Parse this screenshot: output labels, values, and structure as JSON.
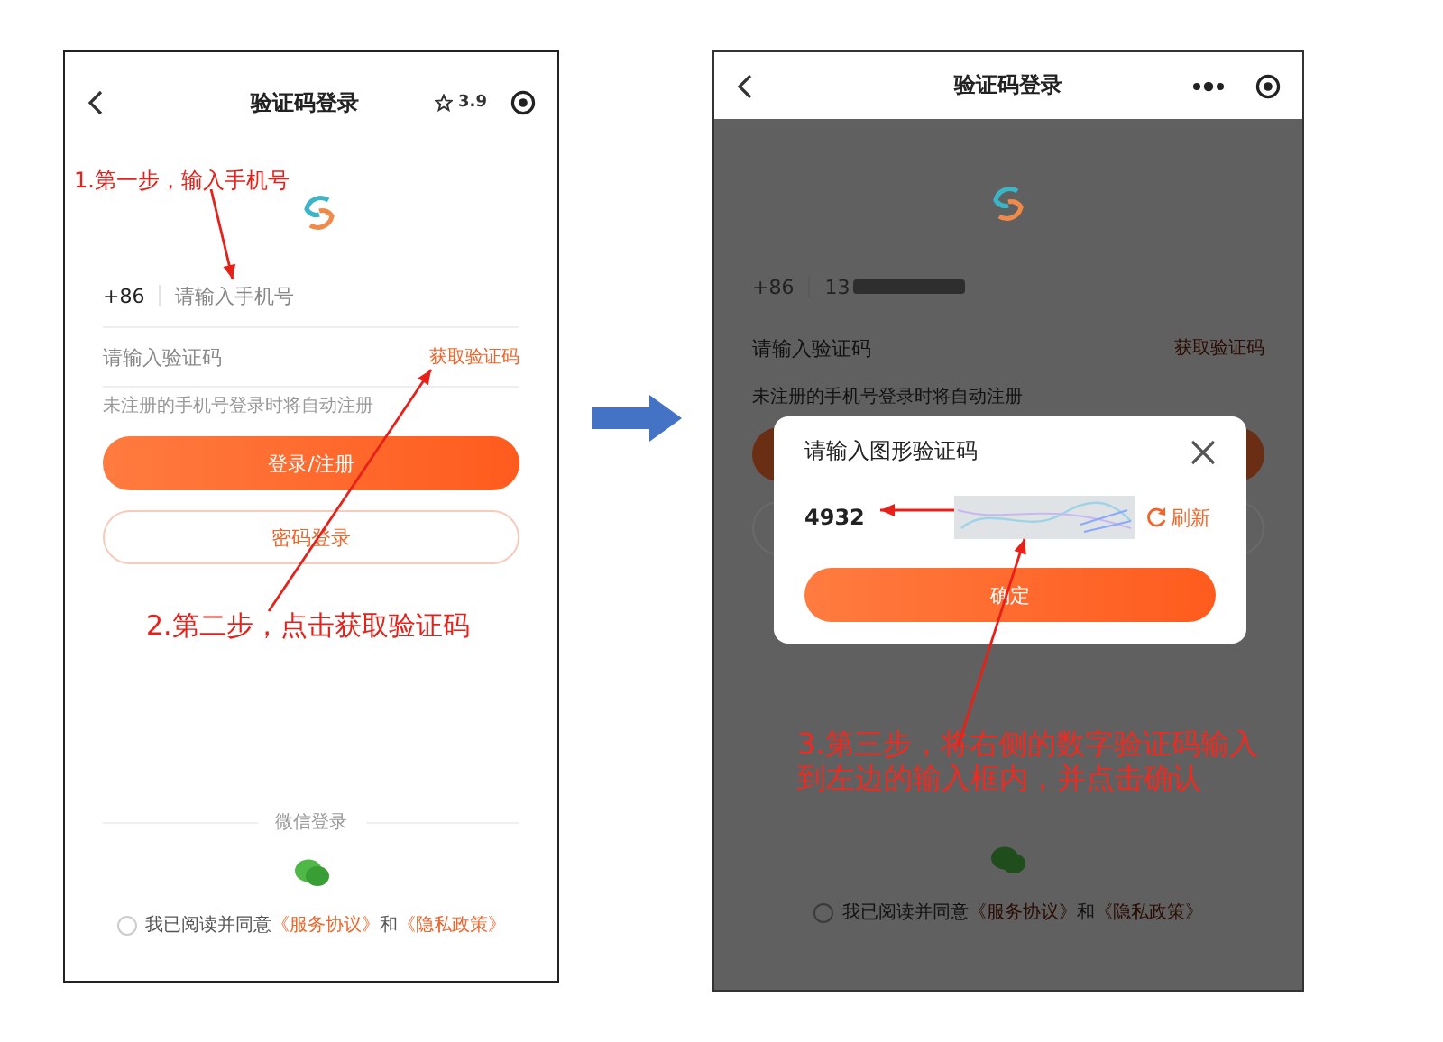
{
  "screens": [
    {
      "dimmed": false,
      "nav": {
        "title": "验证码登录",
        "rating": "3.9"
      },
      "phone_field": {
        "prefix": "+86",
        "placeholder": "请输入手机号"
      },
      "code_field": {
        "placeholder": "请输入验证码",
        "action": "获取验证码"
      },
      "hint": "未注册的手机号登录时将自动注册",
      "buttons": [
        {
          "kind": "primary",
          "label": "登录/注册"
        },
        {
          "kind": "outline",
          "label": "密码登录"
        }
      ],
      "wechat_label": "微信登录",
      "agreement": {
        "checked": false,
        "text": "我已阅读并同意",
        "links": [
          "《服务协议》",
          "《隐私政策》"
        ],
        "joiner": "和"
      },
      "annotations": [
        {
          "text": "1.第一步，输入手机号"
        },
        {
          "text": "2.第二步，点击获取验证码"
        }
      ]
    },
    {
      "dimmed": true,
      "nav": {
        "title": "验证码登录"
      },
      "phone_field": {
        "prefix": "+86",
        "value": "13",
        "masked": true
      },
      "code_field": {
        "placeholder": "请输入验证码",
        "action": "获取验证码"
      },
      "hint": "未注册的手机号登录时将自动注册",
      "buttons": [
        {
          "kind": "primary"
        },
        {
          "kind": "outline"
        }
      ],
      "agreement": {
        "checked": false,
        "text": "我已阅读并同意",
        "links": [
          "《服务协议》",
          "《隐私政策》"
        ],
        "joiner": "和"
      },
      "dialog": {
        "title": "请输入图形验证码",
        "value": "4932",
        "refresh": "刷新",
        "confirm": "确定"
      },
      "annotations": [
        {
          "text": "3.第三步，将右侧的数字验证码输入到左边的输入框内，并点击确认"
        }
      ]
    }
  ]
}
